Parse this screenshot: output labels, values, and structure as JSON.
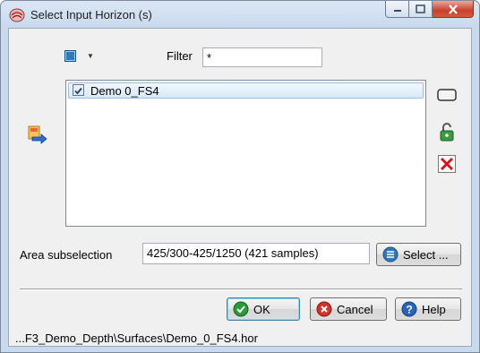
{
  "window": {
    "title": "Select Input Horizon (s)"
  },
  "filter": {
    "label": "Filter",
    "value": "*"
  },
  "horizons": [
    {
      "label": "Demo 0_FS4",
      "checked": true
    }
  ],
  "area_subselection": {
    "label": "Area subselection",
    "value": "425/300-425/1250 (421 samples)",
    "button_label": "Select ..."
  },
  "buttons": {
    "ok": "OK",
    "cancel": "Cancel",
    "help": "Help"
  },
  "status": {
    "path": "...F3_Demo_Depth\\Surfaces\\Demo_0_FS4.hor"
  },
  "icons": {
    "app": "opendtect-icon",
    "swatch": "color-swatch-icon",
    "import": "import-arrow-icon",
    "side_tools": [
      "rectangle-edit-icon",
      "lock-icon",
      "delete-x-icon"
    ]
  },
  "colors": {
    "accent": "#2f7ab8",
    "delete": "#d4161c",
    "ok_green": "#2c9a3b",
    "cancel_red": "#d1342a",
    "help_blue": "#2a64b8"
  }
}
